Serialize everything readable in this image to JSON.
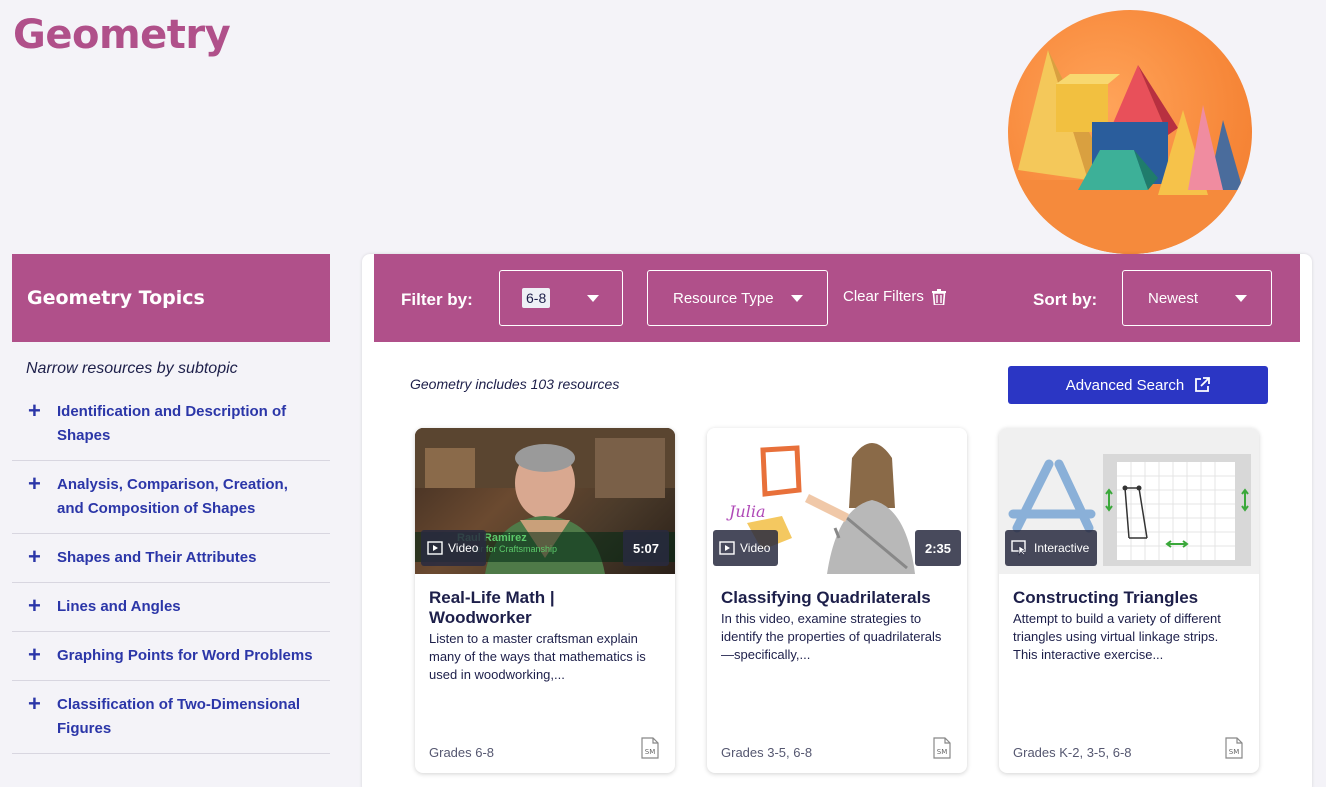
{
  "page": {
    "title": "Geometry"
  },
  "sidebar": {
    "header": "Geometry Topics",
    "subtitle": "Narrow resources by subtopic",
    "topics": [
      {
        "label": "Identification and Description of Shapes"
      },
      {
        "label": "Analysis, Comparison, Creation, and Composition of Shapes"
      },
      {
        "label": "Shapes and Their Attributes"
      },
      {
        "label": "Lines and Angles"
      },
      {
        "label": "Graphing Points for Word Problems"
      },
      {
        "label": "Classification of Two-Dimensional Figures"
      }
    ]
  },
  "filters": {
    "filter_label": "Filter by:",
    "grade_value": "6-8",
    "resource_type": "Resource Type",
    "clear": "Clear Filters",
    "sort_label": "Sort by:",
    "sort_value": "Newest"
  },
  "results": {
    "count_text": "Geometry includes 103 resources",
    "advanced_search": "Advanced Search"
  },
  "cards": [
    {
      "type": "Video",
      "duration": "5:07",
      "caption_name": "Raul Ramirez",
      "caption_sub": "ter for Craftsmanship",
      "title": "Real-Life Math | Woodworker",
      "description": "Listen to a master craftsman explain many of the ways that mathematics is used in woodworking,...",
      "grades": "Grades 6-8",
      "sm": "SM"
    },
    {
      "type": "Video",
      "duration": "2:35",
      "overlay_text": "Julia",
      "title": "Classifying Quadrilaterals",
      "description": "In this video, examine strategies to identify the properties of quadrilaterals—specifically,...",
      "grades": "Grades 3-5, 6-8",
      "sm": "SM"
    },
    {
      "type": "Interactive",
      "title": "Constructing Triangles",
      "description": "Attempt to build a variety of different triangles using virtual linkage strips. This interactive exercise...",
      "grades": "Grades K-2, 3-5, 6-8",
      "sm": "SM"
    }
  ],
  "colors": {
    "brand": "#b0508a",
    "link": "#2b36a8",
    "button": "#2b36c4",
    "background": "#f4f3f8"
  }
}
